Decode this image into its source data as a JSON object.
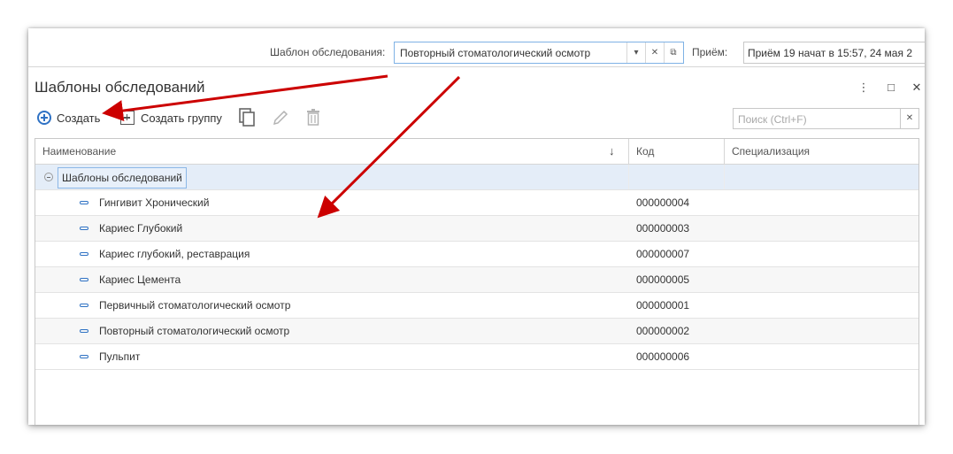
{
  "header": {
    "template_label": "Шаблон обследования:",
    "template_value": "Повторный стоматологический осмотр",
    "reception_label": "Приём:",
    "reception_value": "Приём 19 начат в 15:57, 24 мая 2"
  },
  "form": {
    "title": "Шаблоны обследований",
    "controls": [
      "more-icon",
      "maximize-icon",
      "close-icon"
    ]
  },
  "toolbar": {
    "create_label": "Создать",
    "create_group_label": "Создать группу",
    "icons": [
      "copy-icon",
      "edit-icon",
      "delete-icon"
    ]
  },
  "search": {
    "placeholder": "Поиск (Ctrl+F)"
  },
  "table": {
    "columns": [
      "Наименование",
      "Код",
      "Специализация"
    ],
    "sort_indicator": "↓",
    "group": "Шаблоны обследований",
    "rows": [
      {
        "name": "Гингивит Хронический",
        "code": "000000004",
        "spec": ""
      },
      {
        "name": "Кариес Глубокий",
        "code": "000000003",
        "spec": ""
      },
      {
        "name": "Кариес глубокий, реставрация",
        "code": "000000007",
        "spec": ""
      },
      {
        "name": "Кариес Цемента",
        "code": "000000005",
        "spec": ""
      },
      {
        "name": "Первичный стоматологический осмотр",
        "code": "000000001",
        "spec": ""
      },
      {
        "name": "Повторный стоматологический осмотр",
        "code": "000000002",
        "spec": ""
      },
      {
        "name": "Пульпит",
        "code": "000000006",
        "spec": ""
      }
    ]
  },
  "colors": {
    "accent": "#2f72c4",
    "annotation_arrow": "#cc0000",
    "selected_row": "#e4edf8"
  }
}
